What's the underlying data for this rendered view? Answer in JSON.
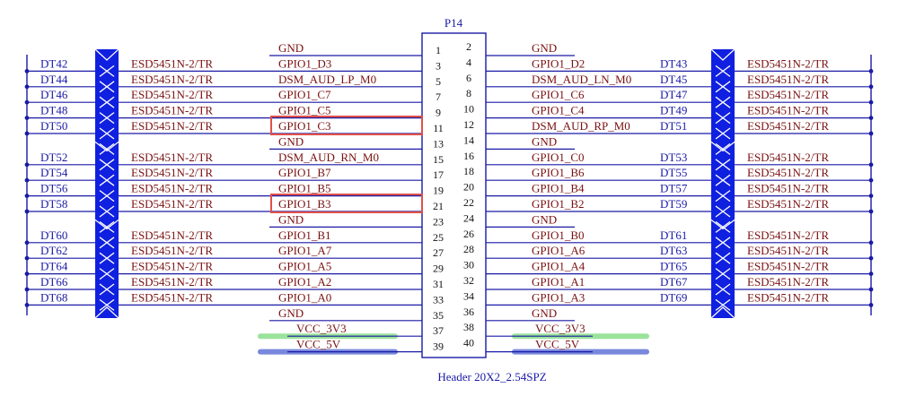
{
  "header": {
    "ref": "P14",
    "part": "Header 20X2_2.54SPZ",
    "pins_left": [
      "1",
      "3",
      "5",
      "7",
      "9",
      "11",
      "13",
      "15",
      "17",
      "19",
      "21",
      "23",
      "25",
      "27",
      "29",
      "31",
      "33",
      "35",
      "37",
      "39"
    ],
    "pins_right": [
      "2",
      "4",
      "6",
      "8",
      "10",
      "12",
      "14",
      "16",
      "18",
      "20",
      "22",
      "24",
      "26",
      "28",
      "30",
      "32",
      "34",
      "36",
      "38",
      "40"
    ]
  },
  "left_rows": [
    {
      "net": "GND",
      "dt": "",
      "esd": ""
    },
    {
      "net": "GPIO1_D3",
      "dt": "DT42",
      "esd": "ESD5451N-2/TR"
    },
    {
      "net": "DSM_AUD_LP_M0",
      "dt": "DT44",
      "esd": "ESD5451N-2/TR"
    },
    {
      "net": "GPIO1_C7",
      "dt": "DT46",
      "esd": "ESD5451N-2/TR"
    },
    {
      "net": "GPIO1_C5",
      "dt": "DT48",
      "esd": "ESD5451N-2/TR"
    },
    {
      "net": "GPIO1_C3",
      "dt": "DT50",
      "esd": "ESD5451N-2/TR"
    },
    {
      "net": "GND",
      "dt": "",
      "esd": ""
    },
    {
      "net": "DSM_AUD_RN_M0",
      "dt": "DT52",
      "esd": "ESD5451N-2/TR"
    },
    {
      "net": "GPIO1_B7",
      "dt": "DT54",
      "esd": "ESD5451N-2/TR"
    },
    {
      "net": "GPIO1_B5",
      "dt": "DT56",
      "esd": "ESD5451N-2/TR"
    },
    {
      "net": "GPIO1_B3",
      "dt": "DT58",
      "esd": "ESD5451N-2/TR"
    },
    {
      "net": "GND",
      "dt": "",
      "esd": ""
    },
    {
      "net": "GPIO1_B1",
      "dt": "DT60",
      "esd": "ESD5451N-2/TR"
    },
    {
      "net": "GPIO1_A7",
      "dt": "DT62",
      "esd": "ESD5451N-2/TR"
    },
    {
      "net": "GPIO1_A5",
      "dt": "DT64",
      "esd": "ESD5451N-2/TR"
    },
    {
      "net": "GPIO1_A2",
      "dt": "DT66",
      "esd": "ESD5451N-2/TR"
    },
    {
      "net": "GPIO1_A0",
      "dt": "DT68",
      "esd": "ESD5451N-2/TR"
    },
    {
      "net": "GND",
      "dt": "",
      "esd": ""
    },
    {
      "net": "VCC_3V3",
      "dt": "",
      "esd": ""
    },
    {
      "net": "VCC_5V",
      "dt": "",
      "esd": ""
    }
  ],
  "right_rows": [
    {
      "net": "GND",
      "dt": "",
      "esd": ""
    },
    {
      "net": "GPIO1_D2",
      "dt": "DT43",
      "esd": "ESD5451N-2/TR"
    },
    {
      "net": "DSM_AUD_LN_M0",
      "dt": "DT45",
      "esd": "ESD5451N-2/TR"
    },
    {
      "net": "GPIO1_C6",
      "dt": "DT47",
      "esd": "ESD5451N-2/TR"
    },
    {
      "net": "GPIO1_C4",
      "dt": "DT49",
      "esd": "ESD5451N-2/TR"
    },
    {
      "net": "DSM_AUD_RP_M0",
      "dt": "DT51",
      "esd": "ESD5451N-2/TR"
    },
    {
      "net": "GND",
      "dt": "",
      "esd": ""
    },
    {
      "net": "GPIO1_C0",
      "dt": "DT53",
      "esd": "ESD5451N-2/TR"
    },
    {
      "net": "GPIO1_B6",
      "dt": "DT55",
      "esd": "ESD5451N-2/TR"
    },
    {
      "net": "GPIO1_B4",
      "dt": "DT57",
      "esd": "ESD5451N-2/TR"
    },
    {
      "net": "GPIO1_B2",
      "dt": "DT59",
      "esd": "ESD5451N-2/TR"
    },
    {
      "net": "GND",
      "dt": "",
      "esd": ""
    },
    {
      "net": "GPIO1_B0",
      "dt": "DT61",
      "esd": "ESD5451N-2/TR"
    },
    {
      "net": "GPIO1_A6",
      "dt": "DT63",
      "esd": "ESD5451N-2/TR"
    },
    {
      "net": "GPIO1_A4",
      "dt": "DT65",
      "esd": "ESD5451N-2/TR"
    },
    {
      "net": "GPIO1_A1",
      "dt": "DT67",
      "esd": "ESD5451N-2/TR"
    },
    {
      "net": "GPIO1_A3",
      "dt": "DT69",
      "esd": "ESD5451N-2/TR"
    },
    {
      "net": "GND",
      "dt": "",
      "esd": ""
    },
    {
      "net": "VCC_3V3",
      "dt": "",
      "esd": ""
    },
    {
      "net": "VCC_5V",
      "dt": "",
      "esd": ""
    }
  ],
  "highlights": [
    "GPIO1_C3",
    "GPIO1_B3"
  ],
  "rail_highlight": {
    "VCC_3V3": "#90e090",
    "VCC_5V": "#6b7bd9"
  },
  "colors": {
    "wire": "#1a1aa6",
    "net_text": "#7a1010",
    "dt_text": "#1a1aa6",
    "esd_text": "#7a1010",
    "diode_fill": "#1020e0",
    "header_stroke": "#1a1aa6",
    "highlight_box": "#e0504a",
    "pin_text": "#111111"
  }
}
